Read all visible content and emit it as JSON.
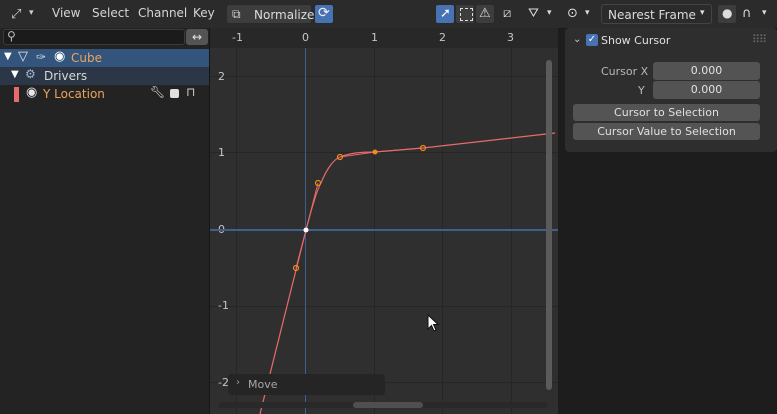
{
  "header": {
    "menus": [
      "View",
      "Select",
      "Channel",
      "Key"
    ],
    "normalize_label": "Normalize",
    "snap_mode": "Nearest Frame"
  },
  "channels": {
    "search_placeholder": "",
    "cube": "Cube",
    "drivers": "Drivers",
    "y_location": "Y Location"
  },
  "graph": {
    "x_ticks": [
      "-1",
      "0",
      "1",
      "2",
      "3"
    ],
    "y_ticks": [
      "2",
      "1",
      "0",
      "-1",
      "-2"
    ],
    "curve_color": "#e86b6b",
    "keyframe_color": "#f08a1c"
  },
  "sidebar": {
    "show_cursor_label": "Show Cursor",
    "show_cursor_checked": true,
    "cursor_x_label": "Cursor X",
    "cursor_x_value": "0.000",
    "y_label": "Y",
    "y_value": "0.000",
    "cursor_to_selection": "Cursor to Selection",
    "cursor_value_to_selection": "Cursor Value to Selection"
  },
  "operator_panel": {
    "label": "Move"
  }
}
